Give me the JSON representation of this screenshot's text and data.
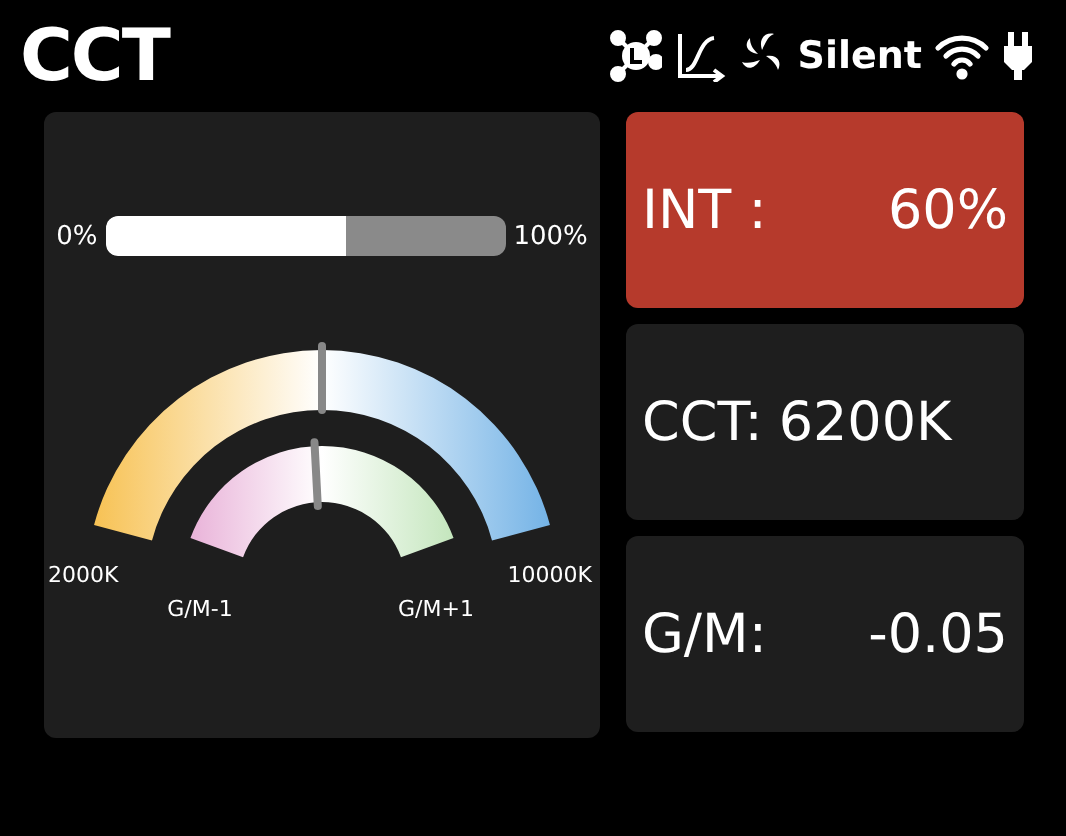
{
  "header": {
    "title": "CCT",
    "status_text": "Silent"
  },
  "intensity_bar": {
    "min_label": "0%",
    "max_label": "100%",
    "level": 0.6
  },
  "cct_gauge": {
    "min_label": "2000K",
    "max_label": "10000K"
  },
  "gm_gauge": {
    "min_label": "G/M-1",
    "max_label": "G/M+1"
  },
  "cards": [
    {
      "label": "INT :",
      "value": "60%",
      "selected": true
    },
    {
      "label": "CCT:",
      "value": "6200K",
      "selected": false
    },
    {
      "label": "G/M:",
      "value": "-0.05",
      "selected": false
    }
  ]
}
